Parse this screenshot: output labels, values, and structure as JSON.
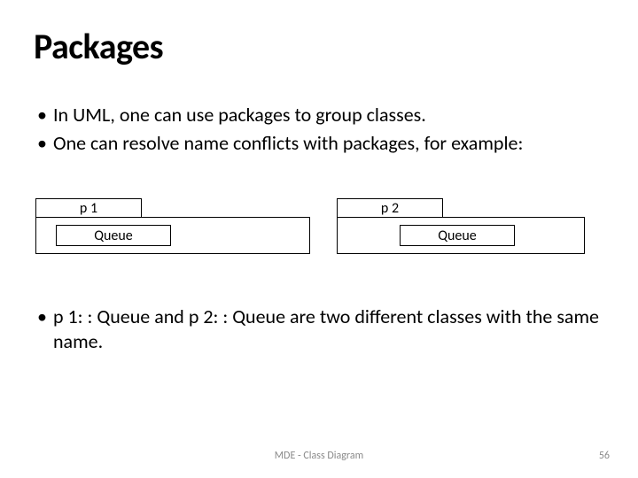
{
  "title": "Packages",
  "bullets_top": [
    "In UML, one can use packages to group classes.",
    "One can resolve name conflicts with packages, for example:"
  ],
  "packages": {
    "p1": {
      "label": "p 1",
      "class": "Queue"
    },
    "p2": {
      "label": "p 2",
      "class": "Queue"
    }
  },
  "bullets_bottom": [
    "p 1: : Queue and p 2: : Queue are two different classes with the same name."
  ],
  "footer": "MDE - Class Diagram",
  "page": "56"
}
